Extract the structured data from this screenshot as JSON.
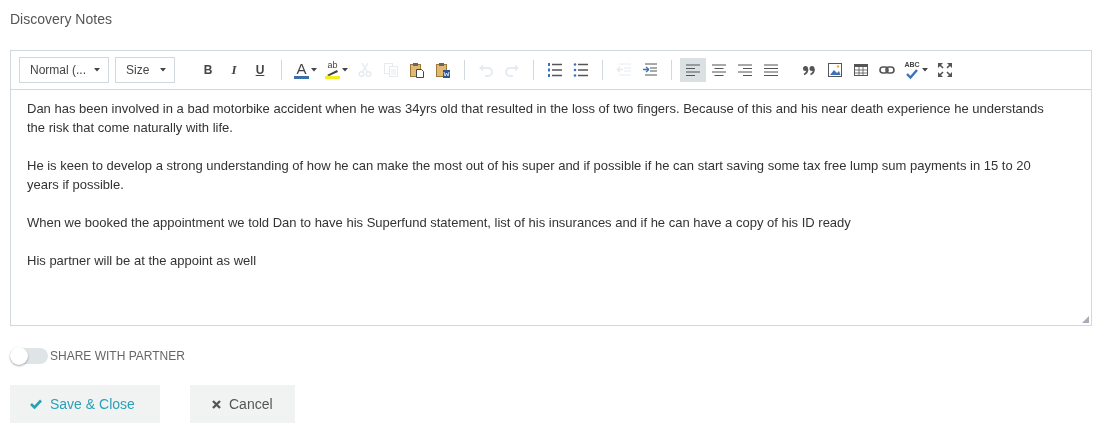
{
  "title": "Discovery Notes",
  "toolbar": {
    "dropdowns": [
      {
        "label": "Normal (..."
      },
      {
        "label": "Size"
      }
    ],
    "groups": [
      [
        {
          "label": "B",
          "disabled": false,
          "selected": false
        },
        {
          "label": "I",
          "disabled": false,
          "selected": false
        },
        {
          "label": "U",
          "disabled": false,
          "selected": false
        }
      ],
      [
        {
          "label": "A",
          "disabled": false,
          "selected": false
        },
        {
          "label": "ab",
          "disabled": false,
          "selected": false
        },
        {
          "disabled": true,
          "selected": false
        },
        {
          "disabled": true,
          "selected": false
        },
        {
          "disabled": false,
          "selected": false
        },
        {
          "disabled": false,
          "selected": false
        }
      ],
      [
        {
          "disabled": true,
          "selected": false
        },
        {
          "disabled": true,
          "selected": false
        }
      ],
      [
        {
          "disabled": false,
          "selected": false
        },
        {
          "disabled": false,
          "selected": false
        }
      ],
      [
        {
          "disabled": true,
          "selected": false
        },
        {
          "disabled": false,
          "selected": false
        }
      ],
      [
        {
          "disabled": false,
          "selected": true
        },
        {
          "disabled": false,
          "selected": false
        },
        {
          "disabled": false,
          "selected": false
        },
        {
          "disabled": false,
          "selected": false
        },
        {
          "disabled": false,
          "selected": false
        },
        {
          "disabled": false,
          "selected": false
        },
        {
          "disabled": false,
          "selected": false
        },
        {
          "disabled": false,
          "selected": false
        },
        {
          "label": "ABC",
          "disabled": false,
          "selected": false
        },
        {
          "disabled": false,
          "selected": false
        }
      ]
    ]
  },
  "paragraphs": [
    "Dan has been involved in a bad motorbike accident when he was 34yrs old that resulted in the loss of two fingers. Because of this and his near death experience he understands the risk that come naturally with life.",
    "He is keen to develop a strong understanding of how he can make the most out of his super and if possible if he can start saving some tax free lump sum payments in 15 to 20 years if possible.",
    "When we booked the appointment we told Dan to have his Superfund statement, list of his insurances and if he can have a copy of his ID ready",
    "His partner will be at the appoint as well"
  ],
  "share_toggle": {
    "label": "SHARE WITH PARTNER",
    "on": false
  },
  "buttons": [
    {
      "label": "Save & Close",
      "kind": "save"
    },
    {
      "label": "Cancel",
      "kind": "cancel"
    }
  ]
}
